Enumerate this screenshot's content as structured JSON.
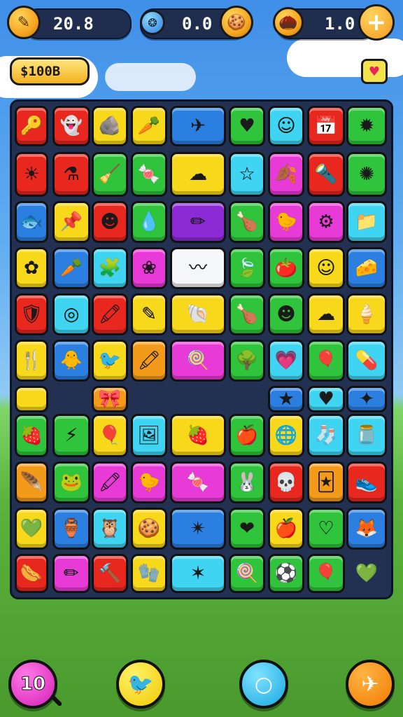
{
  "hud": {
    "left_value": "20.8",
    "middle_value": "0.0",
    "right_value": "1.0",
    "money": "$100B"
  },
  "bottom_bar": {
    "left_button_text": "10"
  },
  "colors": {
    "red": "#e8271f",
    "yellow": "#f8d81a",
    "blue": "#2b7fe0",
    "cyan": "#3fd4f2",
    "green": "#2fc43c",
    "magenta": "#e83ad6",
    "orange": "#f49a1a",
    "purple": "#8c2bd6",
    "white": "#f4f6f8"
  },
  "board": {
    "tiles": [
      {
        "color": "red",
        "icon": "key-icon",
        "glyph": "🔑"
      },
      {
        "color": "red",
        "icon": "ghost-icon",
        "glyph": "👻"
      },
      {
        "color": "yellow",
        "icon": "rock-icon",
        "glyph": "🪨"
      },
      {
        "color": "yellow",
        "icon": "carrot-icon",
        "glyph": "🥕"
      },
      {
        "color": "blue",
        "icon": "paper-plane-icon",
        "glyph": "✈"
      },
      {
        "color": "green",
        "icon": "heart-icon",
        "glyph": "♥"
      },
      {
        "color": "cyan",
        "icon": "smiley-icon",
        "glyph": "☺"
      },
      {
        "color": "red",
        "icon": "calendar-icon",
        "glyph": "📅"
      },
      {
        "color": "green",
        "icon": "splat-icon",
        "glyph": "✹"
      },
      {
        "color": "red",
        "icon": "sun-icon",
        "glyph": "☀"
      },
      {
        "color": "red",
        "icon": "potion-icon",
        "glyph": "⚗"
      },
      {
        "color": "green",
        "icon": "broom-icon",
        "glyph": "🧹"
      },
      {
        "color": "green",
        "icon": "candy-icon",
        "glyph": "🍬"
      },
      {
        "color": "yellow",
        "icon": "cloud-icon",
        "glyph": "☁"
      },
      {
        "color": "cyan",
        "icon": "star-icon",
        "glyph": "☆"
      },
      {
        "color": "magenta",
        "icon": "leaf-icon",
        "glyph": "🍂"
      },
      {
        "color": "red",
        "icon": "torch-icon",
        "glyph": "🔦"
      },
      {
        "color": "green",
        "icon": "starburst-icon",
        "glyph": "✺"
      },
      {
        "color": "blue",
        "icon": "fish-icon",
        "glyph": "🐟"
      },
      {
        "color": "yellow",
        "icon": "pin-icon",
        "glyph": "📌"
      },
      {
        "color": "red",
        "icon": "face-icon",
        "glyph": "☻"
      },
      {
        "color": "green",
        "icon": "drop-icon",
        "glyph": "💧"
      },
      {
        "color": "purple",
        "icon": "pencils-icon",
        "glyph": "✏"
      },
      {
        "color": "green",
        "icon": "drumstick-icon",
        "glyph": "🍗"
      },
      {
        "color": "magenta",
        "icon": "chick-icon",
        "glyph": "🐤"
      },
      {
        "color": "magenta",
        "icon": "gear-icon",
        "glyph": "⚙"
      },
      {
        "color": "cyan",
        "icon": "folder-icon",
        "glyph": "📁"
      },
      {
        "color": "yellow",
        "icon": "flower-icon",
        "glyph": "✿"
      },
      {
        "color": "blue",
        "icon": "carrot-icon",
        "glyph": "🥕"
      },
      {
        "color": "cyan",
        "icon": "puzzle-icon",
        "glyph": "🧩"
      },
      {
        "color": "magenta",
        "icon": "coral-icon",
        "glyph": "❀"
      },
      {
        "color": "white",
        "icon": "ribbon-icon",
        "glyph": "〰"
      },
      {
        "color": "green",
        "icon": "leaf-icon",
        "glyph": "🍃"
      },
      {
        "color": "green",
        "icon": "tomato-icon",
        "glyph": "🍅"
      },
      {
        "color": "yellow",
        "icon": "face-icon",
        "glyph": "☺"
      },
      {
        "color": "blue",
        "icon": "cheese-icon",
        "glyph": "🧀"
      },
      {
        "color": "red",
        "icon": "shield-icon",
        "glyph": "🛡"
      },
      {
        "color": "cyan",
        "icon": "ring-icon",
        "glyph": "◎"
      },
      {
        "color": "red",
        "icon": "crayon-icon",
        "glyph": "🖍"
      },
      {
        "color": "yellow",
        "icon": "pencil-icon",
        "glyph": "✎"
      },
      {
        "color": "yellow",
        "icon": "shell-icon",
        "glyph": "🐚"
      },
      {
        "color": "green",
        "icon": "drumstick-icon",
        "glyph": "🍗"
      },
      {
        "color": "green",
        "icon": "face-icon",
        "glyph": "☻"
      },
      {
        "color": "yellow",
        "icon": "cloud-icon",
        "glyph": "☁"
      },
      {
        "color": "yellow",
        "icon": "ice-cream-icon",
        "glyph": "🍦"
      },
      {
        "color": "yellow",
        "icon": "fork-icon",
        "glyph": "🍴"
      },
      {
        "color": "blue",
        "icon": "chick-icon",
        "glyph": "🐥"
      },
      {
        "color": "yellow",
        "icon": "bird-icon",
        "glyph": "🐦"
      },
      {
        "color": "orange",
        "icon": "crayon-icon",
        "glyph": "🖍"
      },
      {
        "color": "magenta",
        "icon": "candy-icon",
        "glyph": "🍭"
      },
      {
        "color": "green",
        "icon": "tree-icon",
        "glyph": "🌳"
      },
      {
        "color": "cyan",
        "icon": "heart-icon",
        "glyph": "💗"
      },
      {
        "color": "green",
        "icon": "balloon-icon",
        "glyph": "🎈"
      },
      {
        "color": "cyan",
        "icon": "capsule-icon",
        "glyph": "💊"
      },
      {
        "color": "yellow",
        "icon": "blank-icon",
        "glyph": ""
      },
      {
        "color": "orange",
        "icon": "bow-icon",
        "glyph": "🎀"
      },
      {
        "color": "blue",
        "icon": "star-icon",
        "glyph": "★"
      },
      {
        "color": "cyan",
        "icon": "heart-icon",
        "glyph": "♥"
      },
      {
        "color": "blue",
        "icon": "stars-icon",
        "glyph": "✦"
      },
      {
        "color": "green",
        "icon": "radish-icon",
        "glyph": "🍓"
      },
      {
        "color": "green",
        "icon": "bolt-icon",
        "glyph": "⚡"
      },
      {
        "color": "yellow",
        "icon": "balloon-icon",
        "glyph": "🎈"
      },
      {
        "color": "cyan",
        "icon": "frame-icon",
        "glyph": "🖼"
      },
      {
        "color": "yellow",
        "icon": "strawberry-heart-icon",
        "glyph": "🍓"
      },
      {
        "color": "green",
        "icon": "apple-icon",
        "glyph": "🍎"
      },
      {
        "color": "yellow",
        "icon": "globe-icon",
        "glyph": "🌐"
      },
      {
        "color": "cyan",
        "icon": "sock-icon",
        "glyph": "🧦"
      },
      {
        "color": "cyan",
        "icon": "jar-icon",
        "glyph": "🫙"
      },
      {
        "color": "orange",
        "icon": "feather-icon",
        "glyph": "🪶"
      },
      {
        "color": "green",
        "icon": "frog-icon",
        "glyph": "🐸"
      },
      {
        "color": "magenta",
        "icon": "crayon-icon",
        "glyph": "🖍"
      },
      {
        "color": "magenta",
        "icon": "chick-icon",
        "glyph": "🐤"
      },
      {
        "color": "magenta",
        "icon": "candy-icon",
        "glyph": "🍬"
      },
      {
        "color": "green",
        "icon": "bunny-icon",
        "glyph": "🐰"
      },
      {
        "color": "red",
        "icon": "skull-icon",
        "glyph": "💀"
      },
      {
        "color": "orange",
        "icon": "card-icon",
        "glyph": "🃏"
      },
      {
        "color": "red",
        "icon": "shoe-icon",
        "glyph": "👟"
      },
      {
        "color": "yellow",
        "icon": "heart-icon",
        "glyph": "💚"
      },
      {
        "color": "blue",
        "icon": "jar-icon",
        "glyph": "🏺"
      },
      {
        "color": "cyan",
        "icon": "owl-icon",
        "glyph": "🦉"
      },
      {
        "color": "yellow",
        "icon": "cookie-icon",
        "glyph": "🍪"
      },
      {
        "color": "blue",
        "icon": "star-wand-icon",
        "glyph": "✴"
      },
      {
        "color": "green",
        "icon": "heart-icon",
        "glyph": "❤"
      },
      {
        "color": "yellow",
        "icon": "apple-icon",
        "glyph": "🍎"
      },
      {
        "color": "green",
        "icon": "heart-icon",
        "glyph": "♡"
      },
      {
        "color": "blue",
        "icon": "fox-icon",
        "glyph": "🦊"
      },
      {
        "color": "red",
        "icon": "sausage-icon",
        "glyph": "🌭"
      },
      {
        "color": "magenta",
        "icon": "pencil-icon",
        "glyph": "✏"
      },
      {
        "color": "red",
        "icon": "hammer-icon",
        "glyph": "🔨"
      },
      {
        "color": "yellow",
        "icon": "glove-icon",
        "glyph": "🧤"
      },
      {
        "color": "cyan",
        "icon": "stars-icon",
        "glyph": "✶"
      },
      {
        "color": "green",
        "icon": "lollipop-icon",
        "glyph": "🍭"
      },
      {
        "color": "green",
        "icon": "ball-icon",
        "glyph": "⚽"
      },
      {
        "color": "green",
        "icon": "balloon-icon",
        "glyph": "🎈"
      },
      {
        "color": "none",
        "icon": "heart-icon",
        "glyph": "💚"
      }
    ]
  }
}
